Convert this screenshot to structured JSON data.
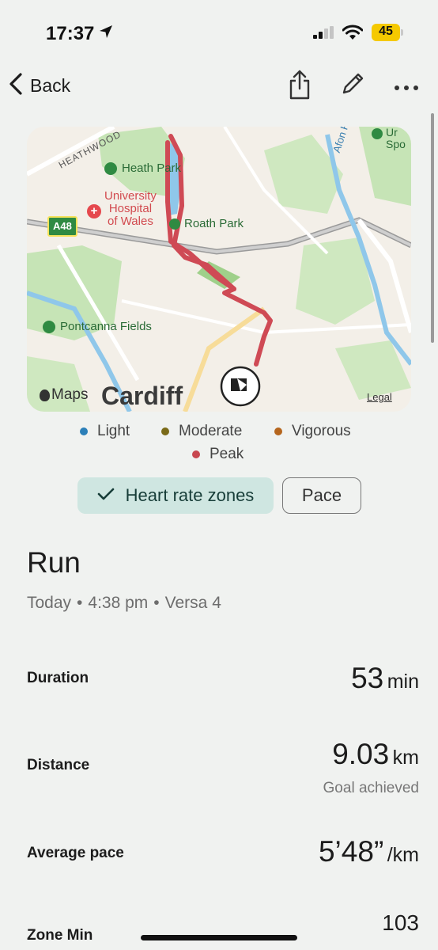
{
  "status_bar": {
    "time": "17:37",
    "battery_level": "45",
    "battery_color": "#f5c900",
    "icons": [
      "location-arrow-icon",
      "cellular-signal-icon",
      "wifi-icon",
      "battery-icon"
    ]
  },
  "nav": {
    "back_label": "Back",
    "icons": [
      "chevron-left-icon",
      "share-icon",
      "pencil-icon",
      "more-icon"
    ]
  },
  "map": {
    "labels": {
      "road_heathwood": "HEATHWOOD",
      "park_heath": "Heath Park",
      "hospital": "University\nHospital\nof Wales",
      "road_a48": "A48",
      "park_roath": "Roath Park",
      "park_pontcanna": "Pontcanna Fields",
      "river_rhymni": "Afon Rhymni",
      "sports": "Ur\nSpo",
      "city": "Cardiff",
      "attribution": "Maps",
      "legal": "Legal"
    },
    "route_color": "#cf4a55"
  },
  "legend": {
    "items": [
      {
        "label": "Light",
        "color": "#2b7fb8"
      },
      {
        "label": "Moderate",
        "color": "#7a6a18"
      },
      {
        "label": "Vigorous",
        "color": "#b5651d"
      },
      {
        "label": "Peak",
        "color": "#c8474f"
      }
    ]
  },
  "toggles": {
    "heart_rate_label": "Heart rate zones",
    "pace_label": "Pace",
    "selected": "Heart rate zones",
    "selected_bg": "#cfe6e1"
  },
  "activity": {
    "title": "Run",
    "date": "Today",
    "time": "4:38 pm",
    "device": "Versa 4",
    "separator": "•"
  },
  "stats": {
    "duration": {
      "label": "Duration",
      "value": "53",
      "unit": "min"
    },
    "distance": {
      "label": "Distance",
      "value": "9.03",
      "unit": "km",
      "note": "Goal achieved"
    },
    "average_pace": {
      "label": "Average pace",
      "value": "5’48”",
      "unit": "/km"
    },
    "zone_min": {
      "label": "Zone Min",
      "value": "103"
    }
  }
}
